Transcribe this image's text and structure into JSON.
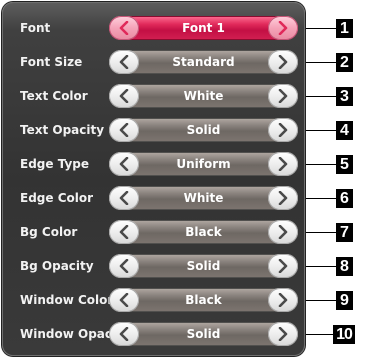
{
  "settings": [
    {
      "label": "Font",
      "value": "Font 1",
      "selected": true,
      "number": "1"
    },
    {
      "label": "Font Size",
      "value": "Standard",
      "selected": false,
      "number": "2"
    },
    {
      "label": "Text Color",
      "value": "White",
      "selected": false,
      "number": "3"
    },
    {
      "label": "Text Opacity",
      "value": "Solid",
      "selected": false,
      "number": "4"
    },
    {
      "label": "Edge Type",
      "value": "Uniform",
      "selected": false,
      "number": "5"
    },
    {
      "label": "Edge Color",
      "value": "White",
      "selected": false,
      "number": "6"
    },
    {
      "label": "Bg Color",
      "value": "Black",
      "selected": false,
      "number": "7"
    },
    {
      "label": "Bg Opacity",
      "value": "Solid",
      "selected": false,
      "number": "8"
    },
    {
      "label": "Window Color",
      "value": "Black",
      "selected": false,
      "number": "9"
    },
    {
      "label": "Window Opacity",
      "value": "Solid",
      "selected": false,
      "number": "10"
    }
  ],
  "icons": {
    "left": "chevron-left-icon",
    "right": "chevron-right-icon"
  },
  "colors": {
    "panel": "#333333",
    "selected_accent": "#d01f50",
    "pill_gray": "#7d7570",
    "callout": "#000000"
  }
}
